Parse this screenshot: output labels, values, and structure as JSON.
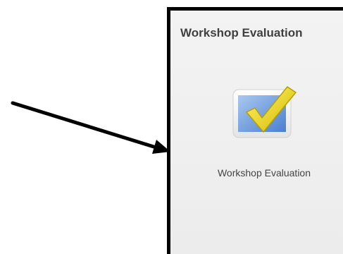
{
  "panel": {
    "title": "Workshop Evaluation"
  },
  "tile": {
    "label": "Workshop Evaluation",
    "icon": "checkmark-form-icon"
  },
  "colors": {
    "arrow": "#000000",
    "panel_border": "#000000",
    "title_text": "#404040",
    "label_text": "#444444",
    "check_yellow": "#e6d21a",
    "box_blue": "#5b8fd6"
  }
}
